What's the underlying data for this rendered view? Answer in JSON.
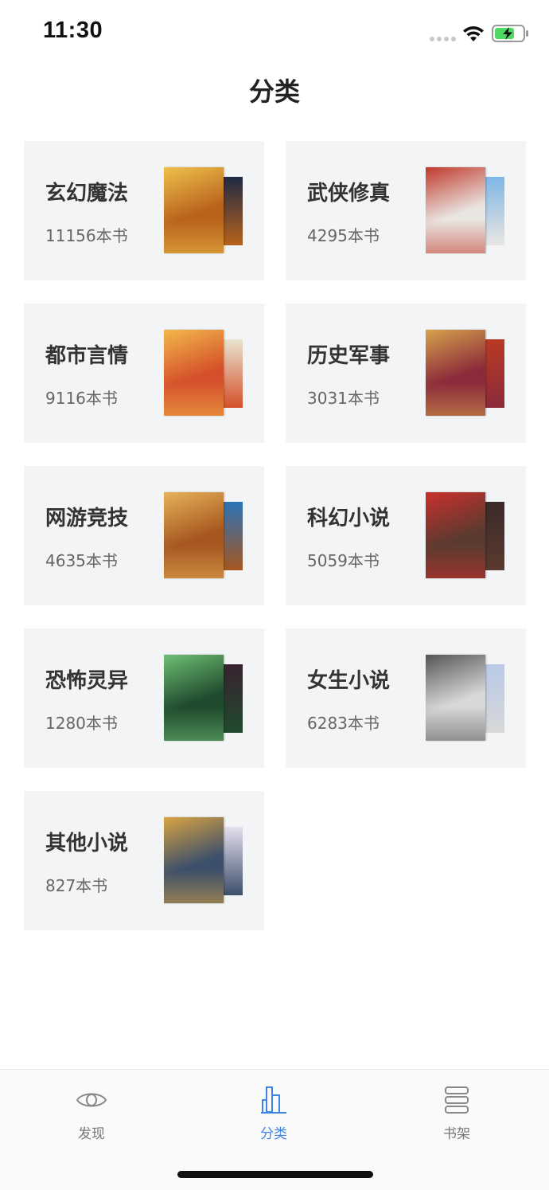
{
  "status_bar": {
    "time": "11:30"
  },
  "nav": {
    "title": "分类"
  },
  "categories": [
    {
      "name": "玄幻魔法",
      "count": "11156本书",
      "cover_front": "#b8621c",
      "cover_accent": "#f0c14b",
      "cover_back": "#1f2a44"
    },
    {
      "name": "武侠修真",
      "count": "4295本书",
      "cover_front": "#e9e6e2",
      "cover_accent": "#c0392b",
      "cover_back": "#7fb6e6"
    },
    {
      "name": "都市言情",
      "count": "9116本书",
      "cover_front": "#d5502a",
      "cover_accent": "#f2b84b",
      "cover_back": "#e9e4d0"
    },
    {
      "name": "历史军事",
      "count": "3031本书",
      "cover_front": "#8b2a3a",
      "cover_accent": "#d6a24c",
      "cover_back": "#b83a25"
    },
    {
      "name": "网游竞技",
      "count": "4635本书",
      "cover_front": "#a6561f",
      "cover_accent": "#e7b25a",
      "cover_back": "#2b73b8"
    },
    {
      "name": "科幻小说",
      "count": "5059本书",
      "cover_front": "#5a3a30",
      "cover_accent": "#c9302c",
      "cover_back": "#3b2a28"
    },
    {
      "name": "恐怖灵异",
      "count": "1280本书",
      "cover_front": "#1f4a2e",
      "cover_accent": "#6fbf73",
      "cover_back": "#3a2230"
    },
    {
      "name": "女生小说",
      "count": "6283本书",
      "cover_front": "#d8d8d8",
      "cover_accent": "#555555",
      "cover_back": "#b9c9e8"
    },
    {
      "name": "其他小说",
      "count": "827本书",
      "cover_front": "#3c4f6b",
      "cover_accent": "#d9a441",
      "cover_back": "#e6e0ee"
    }
  ],
  "tabs": [
    {
      "label": "发现",
      "icon": "eye-icon",
      "active": false
    },
    {
      "label": "分类",
      "icon": "category-chart-icon",
      "active": true
    },
    {
      "label": "书架",
      "icon": "bookshelf-icon",
      "active": false
    }
  ],
  "colors": {
    "accent": "#3d85e6",
    "card_bg": "#f3f4f6",
    "tab_inactive": "#777777"
  }
}
